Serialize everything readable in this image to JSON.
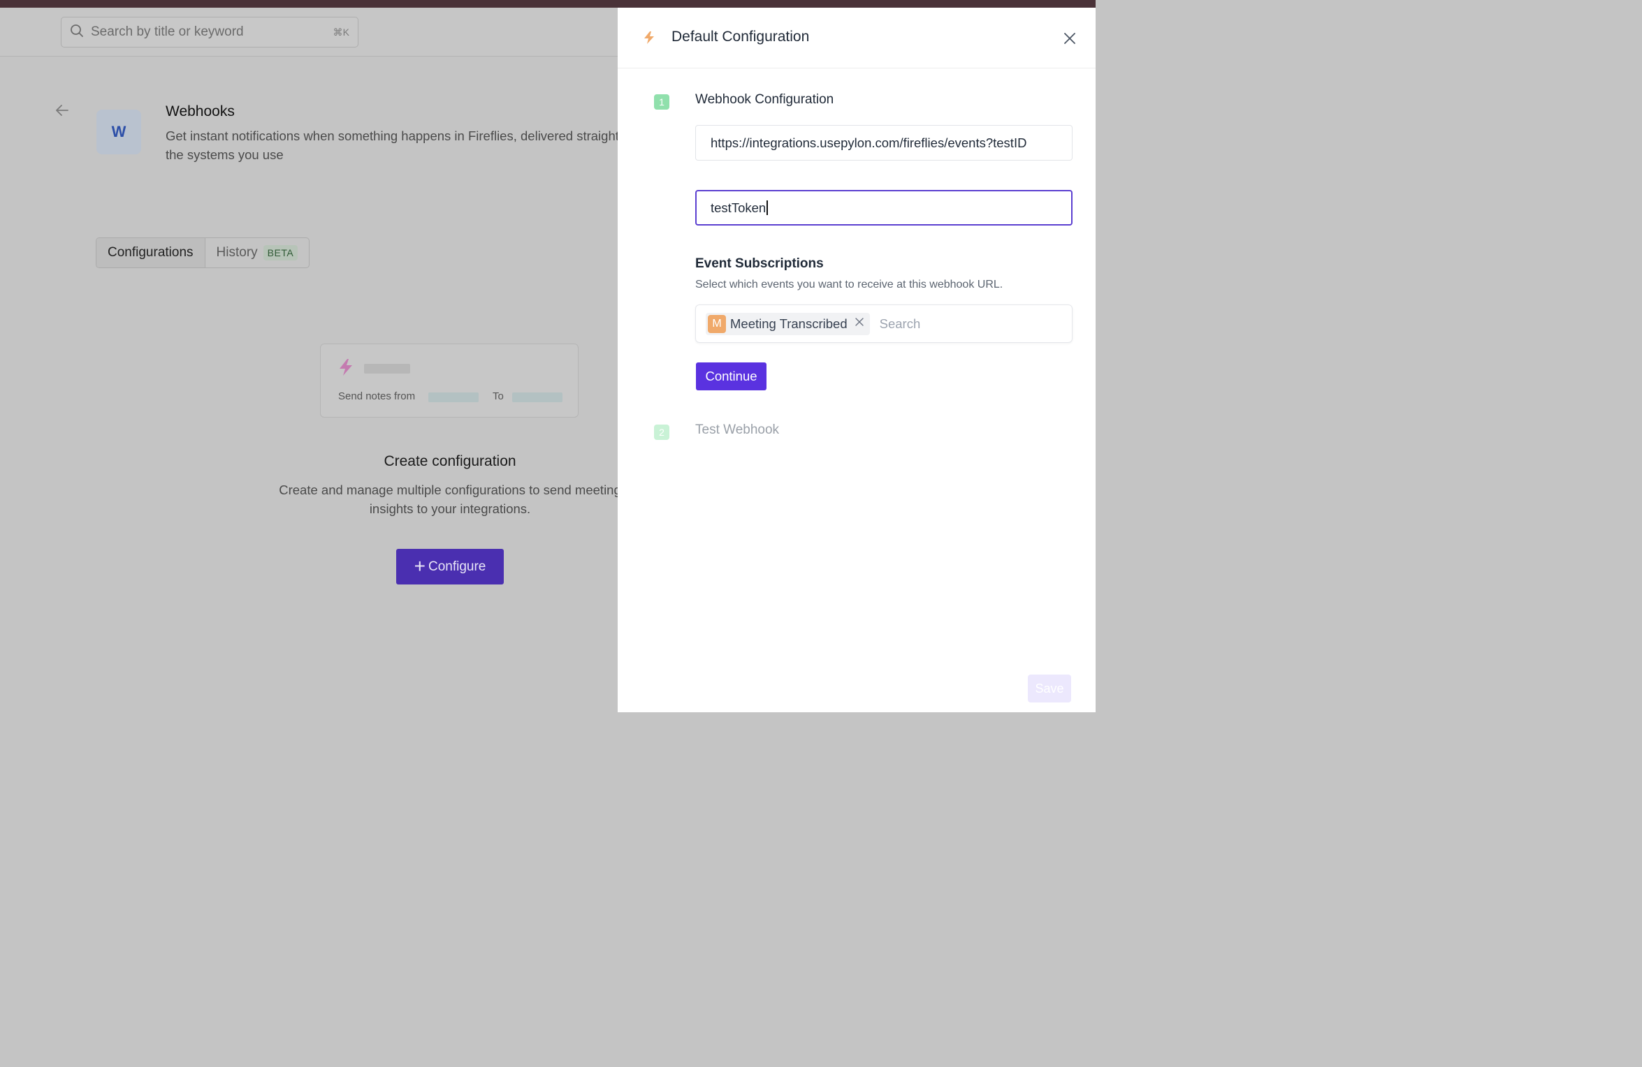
{
  "search": {
    "placeholder": "Search by title or keyword",
    "shortcut": "⌘K"
  },
  "app": {
    "logo_letter": "W",
    "title": "Webhooks",
    "description": "Get instant notifications when something happens in Fireflies, delivered straight to the systems you use"
  },
  "tabs": [
    {
      "label": "Configurations",
      "active": true
    },
    {
      "label": "History",
      "badge": "BETA",
      "active": false
    }
  ],
  "placeholder_card": {
    "from_label": "Send notes from",
    "to_label": "To"
  },
  "empty_state": {
    "title": "Create configuration",
    "description": "Create and manage multiple configurations to send meeting insights to your integrations.",
    "button_label": "Configure"
  },
  "panel": {
    "title": "Default Configuration",
    "steps": [
      {
        "number": "1",
        "title": "Webhook Configuration"
      },
      {
        "number": "2",
        "title": "Test Webhook"
      }
    ],
    "url_value": "https://integrations.usepylon.com/fireflies/events?testID",
    "token_value": "testToken",
    "events": {
      "title": "Event Subscriptions",
      "description": "Select which events you want to receive at this webhook URL.",
      "selected": [
        {
          "initial": "M",
          "label": "Meeting Transcribed"
        }
      ],
      "search_placeholder": "Search"
    },
    "continue_label": "Continue",
    "save_label": "Save"
  },
  "colors": {
    "accent": "#5a32e0",
    "step_active": "#90e0ac",
    "step_inactive": "#c9f2d6",
    "chip_avatar": "#f0a96a",
    "bolt": "#f0a96a",
    "topstrip": "#4a3238"
  }
}
